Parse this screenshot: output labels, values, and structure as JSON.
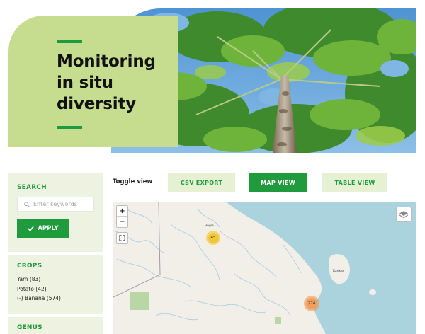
{
  "hero": {
    "title_lines": [
      "Monitoring",
      "in situ",
      "diversity"
    ]
  },
  "sidebar": {
    "search": {
      "heading": "SEARCH",
      "placeholder": "Enter keywords",
      "value": "",
      "apply_label": "APPLY"
    },
    "crops": {
      "heading": "CROPS",
      "items": [
        {
          "label": "Yam (83)"
        },
        {
          "label": "Potato (42)"
        },
        {
          "label": "(-) Banana (574)"
        }
      ]
    },
    "genus": {
      "heading": "GENUS"
    }
  },
  "view": {
    "toggle_label": "Toggle view",
    "csv_export": "CSV EXPORT",
    "map_view": "MAP VIEW",
    "table_view": "TABLE VIEW",
    "active": "MAP VIEW"
  },
  "map": {
    "zoom_in": "+",
    "zoom_out": "−",
    "labels": {
      "city": "Bogia",
      "island": "Kankar"
    },
    "clusters": [
      {
        "count": "45",
        "color": "#f1c73a"
      },
      {
        "count": "274",
        "color": "#ef9e5e"
      }
    ]
  },
  "colors": {
    "brand_green": "#1f9b3d",
    "hero_panel": "#c6dd90",
    "sidebar_bg": "#edf3e0",
    "button_light": "#e6f0d3",
    "water": "#abd3de",
    "land": "#f2efe9"
  },
  "icons": {
    "search": "search-icon",
    "apply": "check-icon",
    "fullscreen": "fullscreen-icon",
    "layers": "layers-icon"
  }
}
